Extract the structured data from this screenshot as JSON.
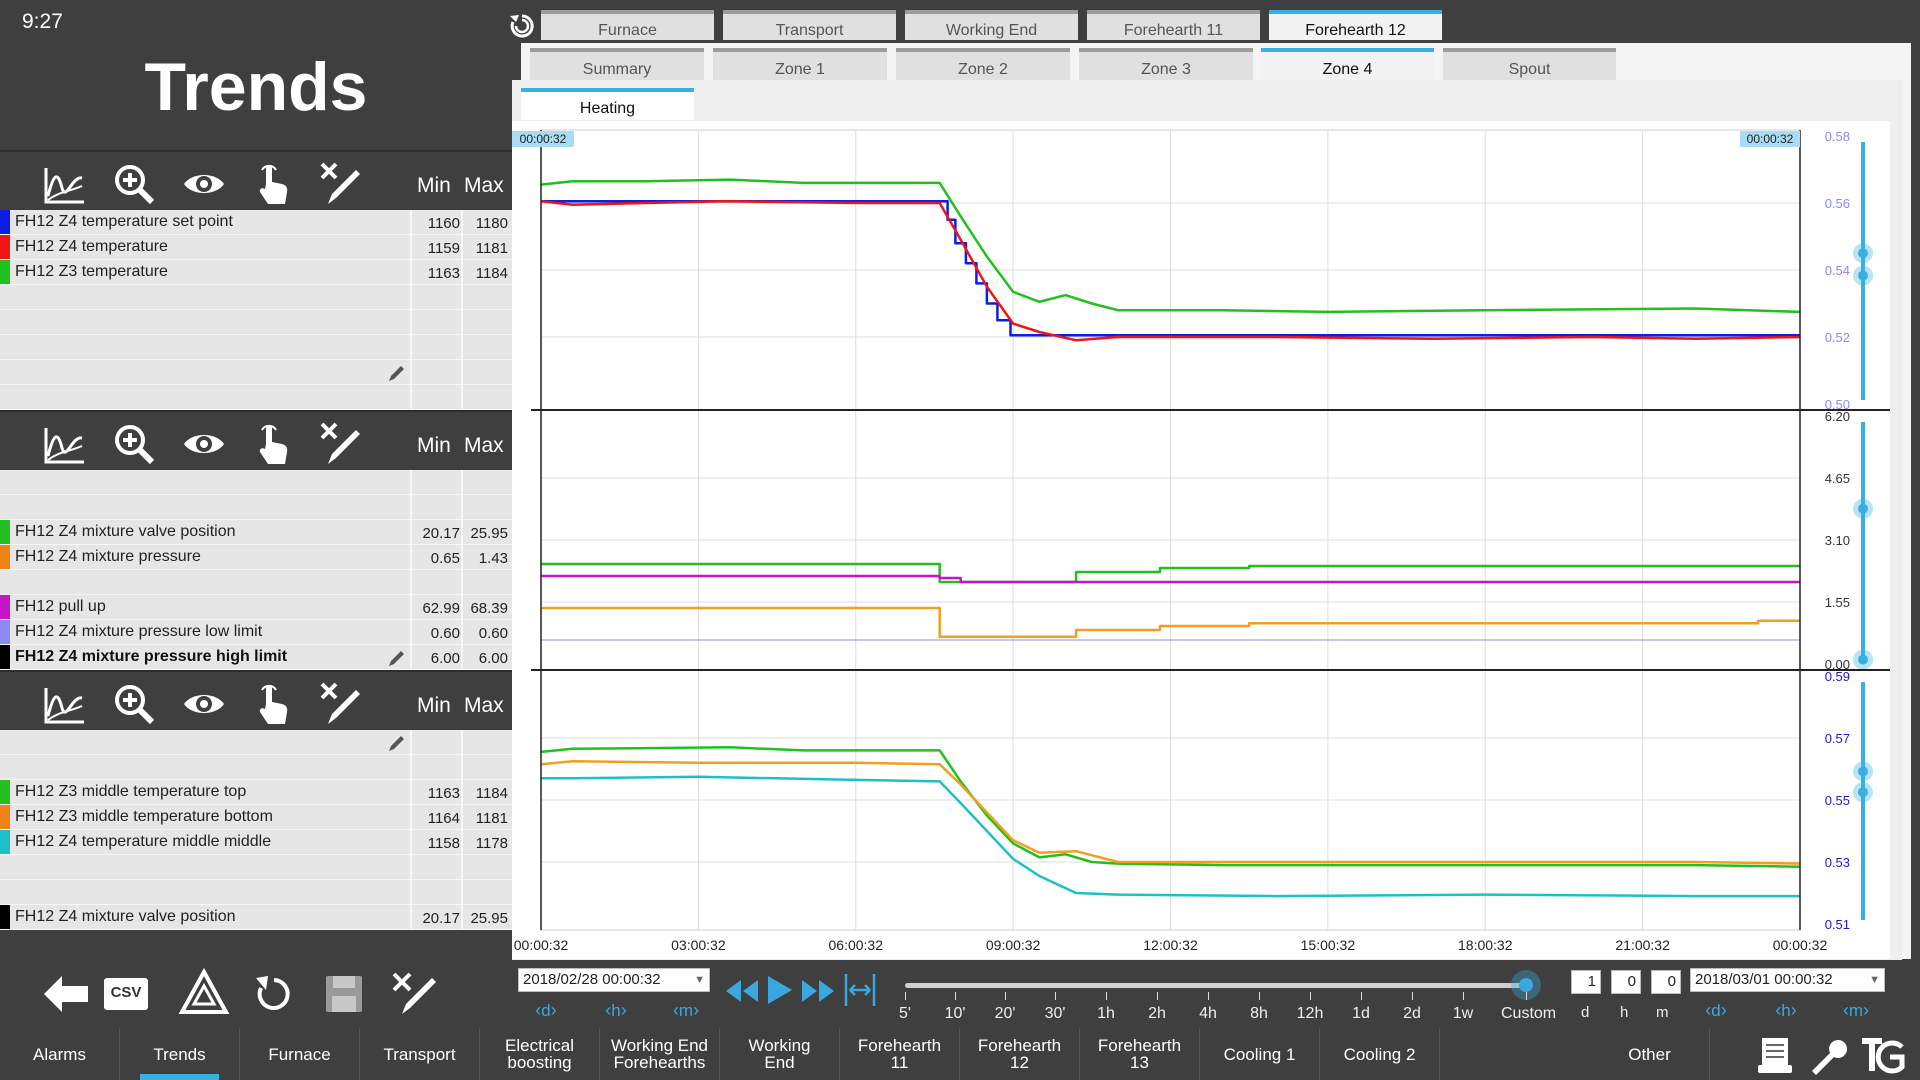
{
  "clock": "9:27",
  "title": "Trends",
  "tabs1": [
    "Furnace",
    "Transport",
    "Working End",
    "Forehearth 11",
    "Forehearth 12"
  ],
  "tabs2": [
    "Summary",
    "Zone 1",
    "Zone 2",
    "Zone 3",
    "Zone 4",
    "Spout"
  ],
  "tab3": "Heating",
  "panel_header": {
    "min": "Min",
    "max": "Max"
  },
  "panels": [
    {
      "rows": [
        {
          "name": "FH12 Z4 temperature set point",
          "color": "#0a1ee6",
          "min": "1160",
          "max": "1180"
        },
        {
          "name": "FH12 Z4 temperature",
          "color": "#f01414",
          "min": "1159",
          "max": "1181"
        },
        {
          "name": "FH12 Z3 temperature",
          "color": "#22c01e",
          "min": "1163",
          "max": "1184"
        },
        {
          "name": "",
          "color": "",
          "min": "",
          "max": ""
        },
        {
          "name": "",
          "color": "",
          "min": "",
          "max": ""
        },
        {
          "name": "",
          "color": "",
          "min": "",
          "max": ""
        },
        {
          "name": "",
          "color": "",
          "min": "",
          "max": ""
        },
        {
          "name": "",
          "color": "",
          "min": "",
          "max": ""
        }
      ]
    },
    {
      "rows": [
        {
          "name": "",
          "color": "",
          "min": "",
          "max": ""
        },
        {
          "name": "",
          "color": "",
          "min": "",
          "max": ""
        },
        {
          "name": "FH12 Z4 mixture valve position",
          "color": "#22c01e",
          "min": "20.17",
          "max": "25.95"
        },
        {
          "name": "FH12 Z4 mixture pressure",
          "color": "#f08214",
          "min": "0.65",
          "max": "1.43"
        },
        {
          "name": "",
          "color": "",
          "min": "",
          "max": ""
        },
        {
          "name": "FH12 pull up",
          "color": "#c814c8",
          "min": "62.99",
          "max": "68.39"
        },
        {
          "name": "FH12 Z4 mixture pressure low limit",
          "color": "#8c8cf0",
          "min": "0.60",
          "max": "0.60"
        },
        {
          "name": "FH12 Z4 mixture pressure high limit",
          "color": "#000000",
          "min": "6.00",
          "max": "6.00",
          "bold": true
        }
      ]
    },
    {
      "rows": [
        {
          "name": "",
          "color": "",
          "min": "",
          "max": ""
        },
        {
          "name": "",
          "color": "",
          "min": "",
          "max": ""
        },
        {
          "name": "FH12 Z3 middle temperature top",
          "color": "#22c01e",
          "min": "1163",
          "max": "1184"
        },
        {
          "name": "FH12 Z3 middle temperature bottom",
          "color": "#f08214",
          "min": "1164",
          "max": "1181"
        },
        {
          "name": "FH12 Z4 temperature middle middle",
          "color": "#1ec0c8",
          "min": "1158",
          "max": "1178"
        },
        {
          "name": "",
          "color": "",
          "min": "",
          "max": ""
        },
        {
          "name": "",
          "color": "",
          "min": "",
          "max": ""
        },
        {
          "name": "FH12 Z4 mixture valve position",
          "color": "#000000",
          "min": "20.17",
          "max": "25.95"
        }
      ]
    }
  ],
  "cursor_time_left": "00:00:32",
  "cursor_time_right": "00:00:32",
  "chart_data": [
    {
      "type": "line",
      "x_ticks": [
        "00:00:32",
        "03:00:32",
        "06:00:32",
        "09:00:32",
        "12:00:32",
        "15:00:32",
        "18:00:32",
        "21:00:32",
        "00:00:32"
      ],
      "y_ticks": [
        "0.58",
        "0.56",
        "0.54",
        "0.52",
        "0.50"
      ],
      "y_color": "#8a8af0",
      "series": [
        {
          "name": "FH12 Z4 temperature set point",
          "color": "#0a1ee6",
          "step": true,
          "points": [
            [
              0,
              0.5605
            ],
            [
              7.6,
              0.5605
            ],
            [
              7.75,
              0.555
            ],
            [
              7.9,
              0.548
            ],
            [
              8.1,
              0.542
            ],
            [
              8.3,
              0.536
            ],
            [
              8.5,
              0.53
            ],
            [
              8.7,
              0.525
            ],
            [
              8.95,
              0.5205
            ],
            [
              24,
              0.5205
            ]
          ]
        },
        {
          "name": "FH12 Z4 temperature",
          "color": "#f01414",
          "points": [
            [
              0,
              0.5605
            ],
            [
              0.6,
              0.5595
            ],
            [
              3.5,
              0.5605
            ],
            [
              6,
              0.56
            ],
            [
              7.6,
              0.56
            ],
            [
              8.0,
              0.549
            ],
            [
              8.5,
              0.535
            ],
            [
              9.0,
              0.524
            ],
            [
              9.5,
              0.5215
            ],
            [
              10.2,
              0.519
            ],
            [
              11,
              0.52
            ],
            [
              14,
              0.52
            ],
            [
              17,
              0.5195
            ],
            [
              20,
              0.52
            ],
            [
              22,
              0.5195
            ],
            [
              24,
              0.52
            ]
          ]
        },
        {
          "name": "FH12 Z3 temperature",
          "color": "#22c01e",
          "points": [
            [
              0,
              0.5655
            ],
            [
              0.6,
              0.5665
            ],
            [
              2,
              0.5665
            ],
            [
              3.6,
              0.567
            ],
            [
              5,
              0.566
            ],
            [
              7.6,
              0.566
            ],
            [
              8.0,
              0.556
            ],
            [
              8.5,
              0.544
            ],
            [
              9.0,
              0.5335
            ],
            [
              9.5,
              0.5305
            ],
            [
              10.0,
              0.5325
            ],
            [
              10.5,
              0.53
            ],
            [
              11,
              0.528
            ],
            [
              13,
              0.528
            ],
            [
              15,
              0.5275
            ],
            [
              18,
              0.528
            ],
            [
              22,
              0.5285
            ],
            [
              24,
              0.5275
            ]
          ]
        }
      ]
    },
    {
      "type": "line",
      "y_ticks": [
        "6.20",
        "4.65",
        "3.10",
        "1.55",
        "0.00"
      ],
      "y_color": "#333333",
      "series": [
        {
          "name": "FH12 Z4 mixture valve position",
          "color": "#22c01e",
          "step": true,
          "points": [
            [
              0,
              2.5
            ],
            [
              7.6,
              2.5
            ],
            [
              7.6,
              2.05
            ],
            [
              10.2,
              2.05
            ],
            [
              10.2,
              2.3
            ],
            [
              11.8,
              2.3
            ],
            [
              11.8,
              2.4
            ],
            [
              13.5,
              2.4
            ],
            [
              13.5,
              2.45
            ],
            [
              24,
              2.45
            ]
          ]
        },
        {
          "name": "FH12 pull up",
          "color": "#c814c8",
          "step": true,
          "points": [
            [
              0,
              2.2
            ],
            [
              7.6,
              2.2
            ],
            [
              7.6,
              2.15
            ],
            [
              8.0,
              2.15
            ],
            [
              8.0,
              2.05
            ],
            [
              24,
              2.05
            ]
          ]
        },
        {
          "name": "FH12 Z4 mixture pressure",
          "color": "#f0a01e",
          "step": true,
          "points": [
            [
              0,
              1.4
            ],
            [
              7.6,
              1.4
            ],
            [
              7.6,
              0.68
            ],
            [
              10.2,
              0.68
            ],
            [
              10.2,
              0.85
            ],
            [
              11.8,
              0.85
            ],
            [
              11.8,
              0.95
            ],
            [
              13.5,
              0.95
            ],
            [
              13.5,
              1.02
            ],
            [
              18,
              1.02
            ],
            [
              23.2,
              1.02
            ],
            [
              23.2,
              1.08
            ],
            [
              24,
              1.08
            ]
          ]
        },
        {
          "name": "FH12 Z4 mixture pressure low limit",
          "color": "#8c8cf0",
          "points": [
            [
              0,
              0.6
            ],
            [
              24,
              0.6
            ]
          ]
        }
      ]
    },
    {
      "type": "line",
      "y_ticks": [
        "0.59",
        "0.57",
        "0.55",
        "0.53",
        "0.51"
      ],
      "y_color": "#1a1ad0",
      "series": [
        {
          "name": "FH12 Z3 middle temperature top",
          "color": "#22c01e",
          "points": [
            [
              0,
              0.5655
            ],
            [
              0.6,
              0.5665
            ],
            [
              3.6,
              0.567
            ],
            [
              5,
              0.566
            ],
            [
              7.6,
              0.566
            ],
            [
              8.0,
              0.556
            ],
            [
              8.5,
              0.545
            ],
            [
              9.0,
              0.536
            ],
            [
              9.5,
              0.5315
            ],
            [
              10.0,
              0.5325
            ],
            [
              10.5,
              0.53
            ],
            [
              11,
              0.5295
            ],
            [
              13,
              0.529
            ],
            [
              15,
              0.529
            ],
            [
              18,
              0.529
            ],
            [
              22,
              0.529
            ],
            [
              24,
              0.5285
            ]
          ]
        },
        {
          "name": "FH12 Z3 middle temperature bottom",
          "color": "#f0a01e",
          "points": [
            [
              0,
              0.5615
            ],
            [
              0.6,
              0.5625
            ],
            [
              3,
              0.562
            ],
            [
              6,
              0.562
            ],
            [
              7.6,
              0.5615
            ],
            [
              8.0,
              0.555
            ],
            [
              8.5,
              0.546
            ],
            [
              9.0,
              0.537
            ],
            [
              9.5,
              0.533
            ],
            [
              10.2,
              0.5335
            ],
            [
              11,
              0.53
            ],
            [
              14,
              0.53
            ],
            [
              18,
              0.53
            ],
            [
              22,
              0.53
            ],
            [
              24,
              0.5295
            ]
          ]
        },
        {
          "name": "FH12 Z4 temperature middle middle",
          "color": "#1ec0c8",
          "points": [
            [
              0,
              0.557
            ],
            [
              0.6,
              0.557
            ],
            [
              3,
              0.5575
            ],
            [
              6,
              0.5565
            ],
            [
              7.6,
              0.556
            ],
            [
              8.0,
              0.549
            ],
            [
              8.5,
              0.54
            ],
            [
              9.0,
              0.531
            ],
            [
              9.5,
              0.5255
            ],
            [
              10.2,
              0.52
            ],
            [
              11,
              0.5195
            ],
            [
              14,
              0.519
            ],
            [
              18,
              0.5195
            ],
            [
              22,
              0.519
            ],
            [
              24,
              0.519
            ]
          ]
        }
      ]
    }
  ],
  "start_date": "2018/02/28 00:00:32",
  "end_date": "2018/03/01 00:00:32",
  "nav_units": [
    "d",
    "h",
    "m"
  ],
  "scale_labels": [
    "5'",
    "10'",
    "20'",
    "30'",
    "1h",
    "2h",
    "4h",
    "8h",
    "12h",
    "1d",
    "2d",
    "1w",
    "Custom"
  ],
  "duration": {
    "d": "1",
    "h": "0",
    "m": "0"
  },
  "duration_units": [
    "d",
    "h",
    "m"
  ],
  "csv_label": "CSV",
  "bottom_nav": [
    {
      "l1": "Alarms",
      "l2": ""
    },
    {
      "l1": "Trends",
      "l2": ""
    },
    {
      "l1": "Furnace",
      "l2": ""
    },
    {
      "l1": "Transport",
      "l2": ""
    },
    {
      "l1": "Electrical",
      "l2": "boosting"
    },
    {
      "l1": "Working End",
      "l2": "Forehearths"
    },
    {
      "l1": "Working",
      "l2": "End"
    },
    {
      "l1": "Forehearth",
      "l2": "11"
    },
    {
      "l1": "Forehearth",
      "l2": "12"
    },
    {
      "l1": "Forehearth",
      "l2": "13"
    },
    {
      "l1": "Cooling 1",
      "l2": ""
    },
    {
      "l1": "Cooling 2",
      "l2": ""
    },
    {
      "l1": "Other",
      "l2": ""
    }
  ],
  "icons": [
    "trend-line-icon",
    "zoom-icon",
    "eye-icon",
    "touch-icon",
    "delete-pen-icon",
    "pencil-icon",
    "back-arrow-icon",
    "recycle-icon",
    "refresh-icon",
    "save-icon",
    "report-icon",
    "wrench-icon",
    "logo-icon"
  ]
}
